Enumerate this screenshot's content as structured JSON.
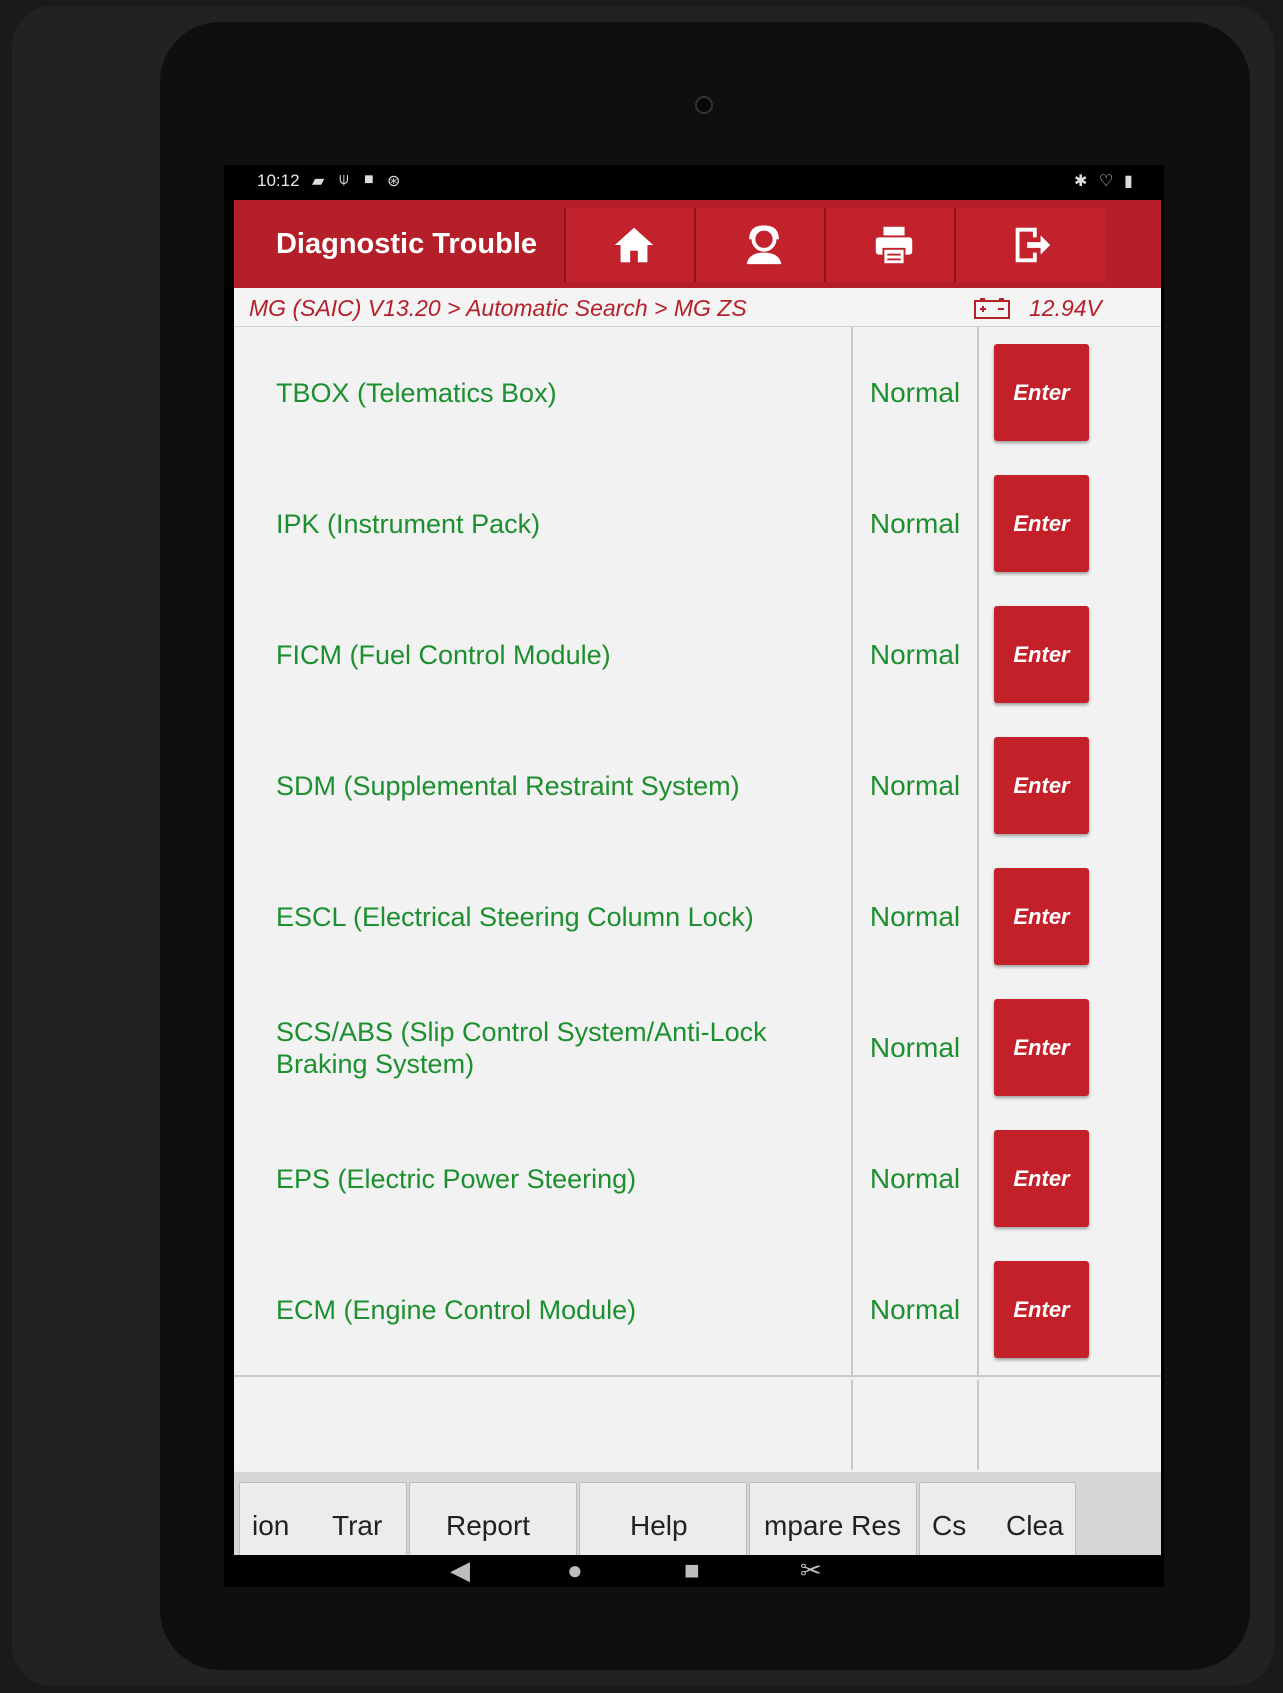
{
  "status_bar": {
    "time": "10:12"
  },
  "toolbar": {
    "title": "Diagnostic Trouble",
    "buttons": [
      {
        "icon": "home-icon"
      },
      {
        "icon": "support-agent-icon"
      },
      {
        "icon": "printer-icon"
      },
      {
        "icon": "exit-icon"
      }
    ]
  },
  "breadcrumb": {
    "path": "MG (SAIC) V13.20 > Automatic Search > MG ZS",
    "voltage": "12.94V"
  },
  "systems": [
    {
      "name": "TBOX (Telematics Box)",
      "status": "Normal",
      "action": "Enter"
    },
    {
      "name": "IPK (Instrument Pack)",
      "status": "Normal",
      "action": "Enter"
    },
    {
      "name": "FICM (Fuel Control Module)",
      "status": "Normal",
      "action": "Enter"
    },
    {
      "name": "SDM (Supplemental Restraint System)",
      "status": "Normal",
      "action": "Enter"
    },
    {
      "name": "ESCL (Electrical Steering Column Lock)",
      "status": "Normal",
      "action": "Enter"
    },
    {
      "name": "SCS/ABS (Slip Control System/Anti-Lock Braking System)",
      "status": "Normal",
      "action": "Enter"
    },
    {
      "name": "EPS (Electric Power Steering)",
      "status": "Normal",
      "action": "Enter"
    },
    {
      "name": "ECM (Engine Control Module)",
      "status": "Normal",
      "action": "Enter"
    }
  ],
  "bottom_bar": {
    "btn1": {
      "left": "ion",
      "right": "Trar"
    },
    "btn2": "Report",
    "btn3": "Help",
    "btn4": "mpare Res",
    "btn5": {
      "left": "Cs",
      "right": "Clea"
    }
  },
  "colors": {
    "accent_red": "#b51f29",
    "status_green": "#1c8f2e"
  }
}
